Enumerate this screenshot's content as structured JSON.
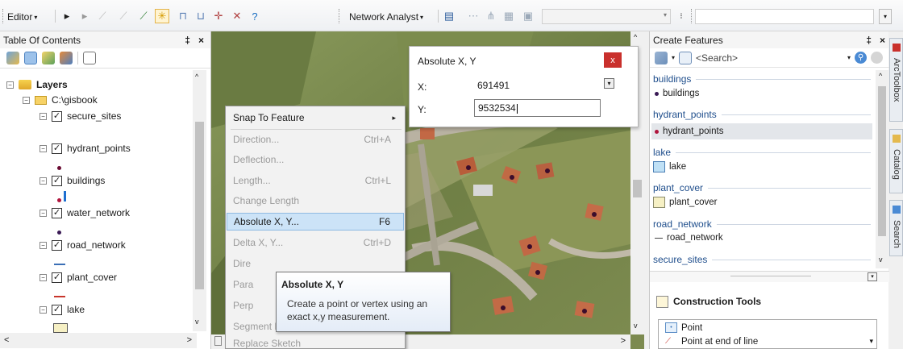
{
  "toolbar": {
    "editor_label": "Editor",
    "network_analyst_label": "Network Analyst",
    "search_value": ""
  },
  "toc": {
    "title": "Table Of Contents",
    "pin": "‡",
    "close": "×",
    "root_label": "Layers",
    "folder_label": "C:\\gisbook",
    "layers": [
      {
        "name": "secure_sites"
      },
      {
        "name": "hydrant_points"
      },
      {
        "name": "buildings"
      },
      {
        "name": "water_network"
      },
      {
        "name": "road_network"
      },
      {
        "name": "plant_cover"
      },
      {
        "name": "lake"
      }
    ]
  },
  "dialog": {
    "title": "Absolute X, Y",
    "close_label": "x",
    "x_label": "X:",
    "y_label": "Y:",
    "x_value": "691491",
    "y_value": "9532534"
  },
  "menu": {
    "items": [
      {
        "label": "Snap To Feature",
        "shortcut": "▸",
        "state": "normal"
      },
      {
        "label": "Direction...",
        "shortcut": "Ctrl+A",
        "state": "disabled"
      },
      {
        "label": "Deflection...",
        "shortcut": "",
        "state": "disabled"
      },
      {
        "label": "Length...",
        "shortcut": "Ctrl+L",
        "state": "disabled"
      },
      {
        "label": "Change Length",
        "shortcut": "",
        "state": "disabled"
      },
      {
        "label": "Absolute X, Y...",
        "shortcut": "F6",
        "state": "active"
      },
      {
        "label": "Delta X, Y...",
        "shortcut": "Ctrl+D",
        "state": "disabled"
      },
      {
        "label": "Dire",
        "shortcut": "",
        "state": "disabled"
      },
      {
        "label": "Para",
        "shortcut": "",
        "state": "disabled"
      },
      {
        "label": "Perp",
        "shortcut": "",
        "state": "disabled"
      },
      {
        "label": "Segment Deflection...",
        "shortcut": "F7",
        "state": "disabled"
      },
      {
        "label": "Replace Sketch",
        "shortcut": "",
        "state": "disabled"
      }
    ]
  },
  "tooltip": {
    "title": "Absolute X, Y",
    "body": "Create a point or vertex using an exact x,y measurement."
  },
  "create_features": {
    "title": "Create Features",
    "search_placeholder": "<Search>",
    "templates": [
      {
        "group": "buildings",
        "item": "buildings",
        "symbol": "dot"
      },
      {
        "group": "hydrant_points",
        "item": "hydrant_points",
        "symbol": "dot"
      },
      {
        "group": "lake",
        "item": "lake",
        "symbol": "rect-blue"
      },
      {
        "group": "plant_cover",
        "item": "plant_cover",
        "symbol": "rect-yellow"
      },
      {
        "group": "road_network",
        "item": "road_network",
        "symbol": "line"
      },
      {
        "group": "secure_sites",
        "item": "",
        "symbol": ""
      }
    ],
    "construction_title": "Construction Tools",
    "tools": [
      "Point",
      "Point at end of line"
    ]
  },
  "side_tabs": [
    "ArcToolbox",
    "Catalog",
    "Search"
  ],
  "colors": {
    "accent_blue": "#1f4e8c",
    "close_red": "#c9302c",
    "lake_fill": "#bfe0f5",
    "plant_fill": "#f6f0c4",
    "road_line": "#c8362c",
    "water_line": "#3b6fb6",
    "point_symbol": "#6a0a32"
  }
}
